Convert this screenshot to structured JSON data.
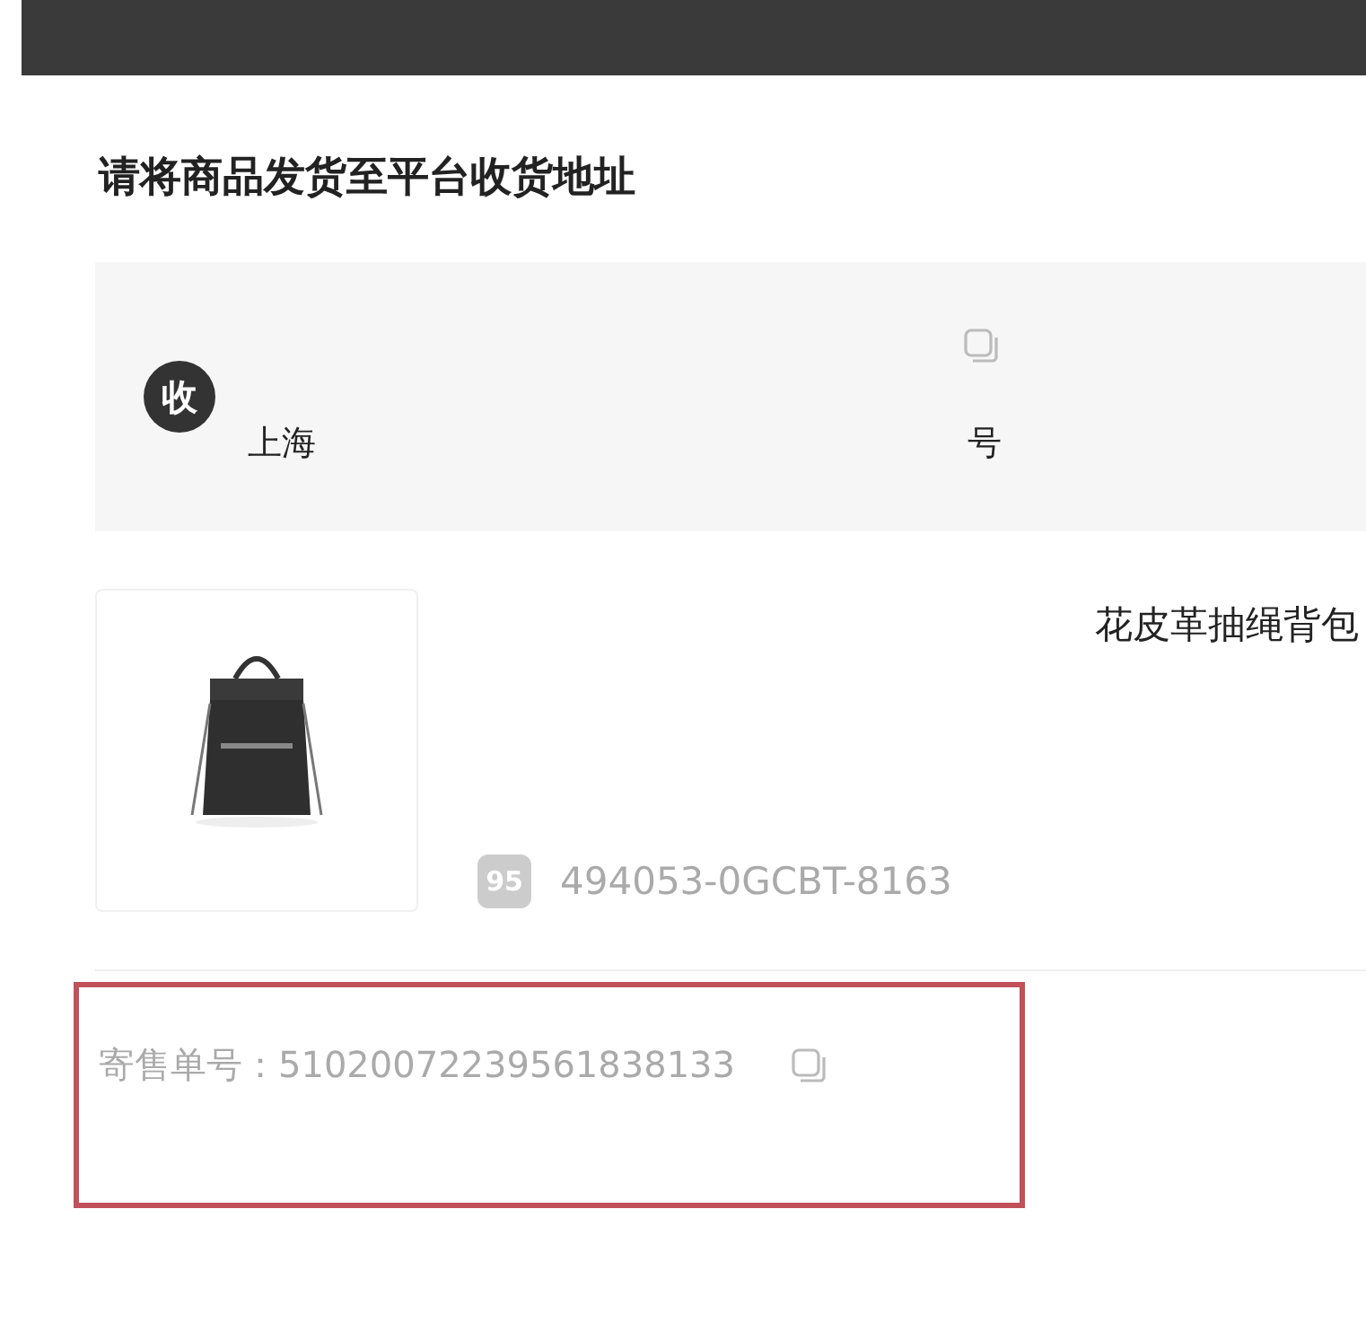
{
  "heading": "请将商品发货至平台收货地址",
  "address": {
    "badge": "收",
    "line_start": "上海",
    "line_end": "号"
  },
  "product": {
    "title": "花皮革抽绳背包",
    "sku_badge": "95",
    "sku": "494053-0GCBT-8163"
  },
  "consignment": {
    "label": "寄售单号：",
    "number": "51020072239561838133",
    "highlighted": true
  }
}
